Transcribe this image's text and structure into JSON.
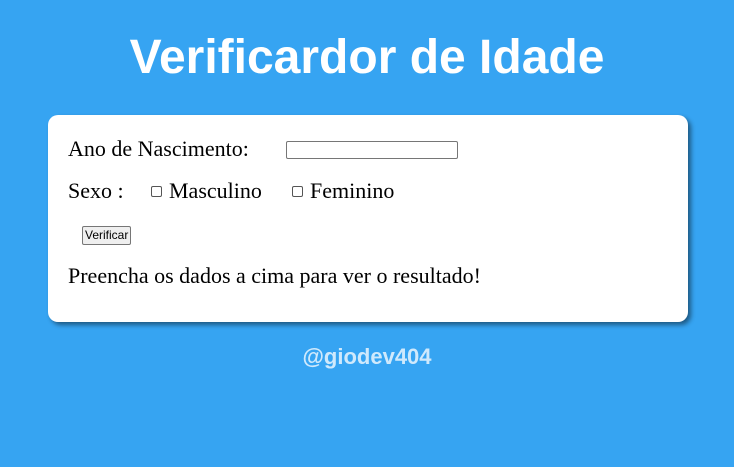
{
  "header": {
    "title": "Verificardor de Idade"
  },
  "form": {
    "birth_year_label": "Ano de Nascimento:",
    "birth_year_value": "",
    "sex_label": "Sexo :",
    "option_male": "Masculino",
    "option_female": "Feminino",
    "male_checked": false,
    "female_checked": false,
    "verify_button": "Verificar",
    "result_text": "Preencha os dados a cima para ver o resultado!"
  },
  "footer": {
    "handle": "@giodev404"
  },
  "colors": {
    "background": "#36a4f2",
    "card": "#ffffff",
    "footer_text": "#cfe9fc"
  }
}
